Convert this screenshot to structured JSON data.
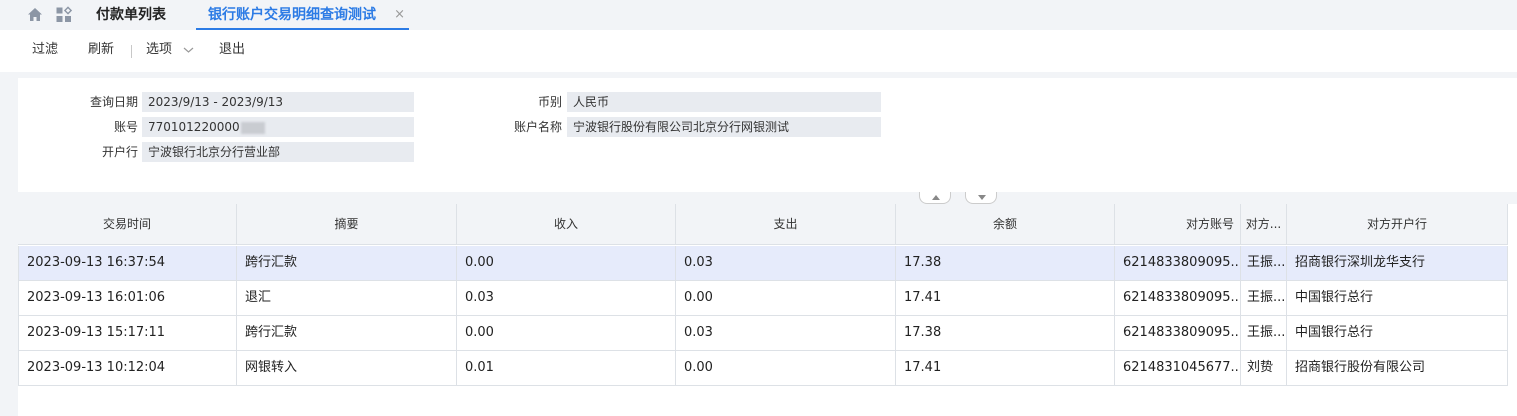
{
  "tabs": [
    {
      "label": "付款单列表"
    },
    {
      "label": "银行账户交易明细查询测试",
      "close": "×"
    }
  ],
  "toolbar": {
    "filter": "过滤",
    "refresh": "刷新",
    "options": "选项",
    "exit": "退出"
  },
  "form": {
    "query_date": {
      "label": "查询日期",
      "value": "2023/9/13 - 2023/9/13"
    },
    "account_no": {
      "label": "账号",
      "value": "770101220000"
    },
    "bank": {
      "label": "开户行",
      "value": "宁波银行北京分行营业部"
    },
    "currency": {
      "label": "币别",
      "value": "人民币"
    },
    "account_name": {
      "label": "账户名称",
      "value": "宁波银行股份有限公司北京分行网银测试"
    }
  },
  "table": {
    "columns": [
      "交易时间",
      "摘要",
      "收入",
      "支出",
      "余额",
      "对方账号",
      "对方...",
      "对方开户行"
    ],
    "rows": [
      [
        "2023-09-13 16:37:54",
        "跨行汇款",
        "0.00",
        "0.03",
        "17.38",
        "6214833809095...",
        "王振...",
        "招商银行深圳龙华支行"
      ],
      [
        "2023-09-13 16:01:06",
        "退汇",
        "0.03",
        "0.00",
        "17.41",
        "6214833809095...",
        "王振...",
        "中国银行总行"
      ],
      [
        "2023-09-13 15:17:11",
        "跨行汇款",
        "0.00",
        "0.03",
        "17.38",
        "6214833809095...",
        "王振...",
        "中国银行总行"
      ],
      [
        "2023-09-13 10:12:04",
        "网银转入",
        "0.01",
        "0.00",
        "17.41",
        "6214831045677...",
        "刘贽",
        "招商银行股份有限公司"
      ]
    ]
  },
  "colors": {
    "accent": "#2c7be5",
    "selected_row": "#e6ebfb",
    "field_bg": "#e8ebf0"
  }
}
